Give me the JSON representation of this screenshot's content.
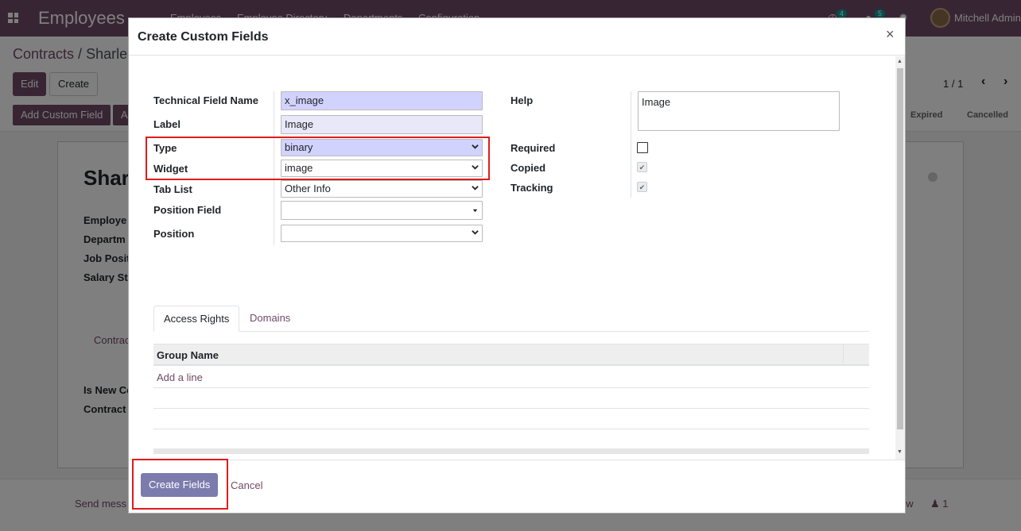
{
  "topbar": {
    "app_name": "Employees",
    "menu": [
      "Employees",
      "Employee Directory",
      "Departments",
      "Configuration"
    ],
    "activity_count": "4",
    "message_count": "5",
    "user": "Mitchell Admin"
  },
  "control_panel": {
    "breadcrumb_root": "Contracts",
    "breadcrumb_sep": "/",
    "breadcrumb_current": "Sharle",
    "edit_label": "Edit",
    "create_label": "Create",
    "pager": "1 / 1",
    "add_custom_field_label": "Add Custom Field",
    "second_button_label": "A",
    "stages": [
      "Expired",
      "Cancelled"
    ]
  },
  "background_form": {
    "name": "Shar",
    "fields": [
      "Employe",
      "Departm",
      "Job Posit",
      "Salary St"
    ],
    "tab": "Contrac",
    "fields2": [
      "Is New Co",
      "Contract"
    ],
    "chatter_send": "Send mess",
    "chatter_follow": "ow",
    "followers": "1"
  },
  "modal": {
    "title": "Create Custom Fields",
    "close": "×",
    "labels": {
      "technical_name": "Technical Field Name",
      "label": "Label",
      "type": "Type",
      "widget": "Widget",
      "tab_list": "Tab List",
      "position_field": "Position Field",
      "position": "Position",
      "help": "Help",
      "required": "Required",
      "copied": "Copied",
      "tracking": "Tracking"
    },
    "values": {
      "technical_name": "x_image",
      "label": "Image",
      "type": "binary",
      "widget": "image",
      "tab_list": "Other Info",
      "position_field": "",
      "position": "",
      "help": "Image"
    },
    "checks": {
      "required": false,
      "copied": true,
      "tracking": true
    },
    "tabs": [
      "Access Rights",
      "Domains"
    ],
    "table": {
      "header": "Group Name",
      "add_line": "Add a line"
    },
    "footer": {
      "create_label": "Create Fields",
      "cancel_label": "Cancel"
    }
  },
  "colors": {
    "brand": "#714b67",
    "highlight_input": "#d2d2ff",
    "annotation_red": "#e01b1b",
    "primary_button": "#7c7bad"
  }
}
